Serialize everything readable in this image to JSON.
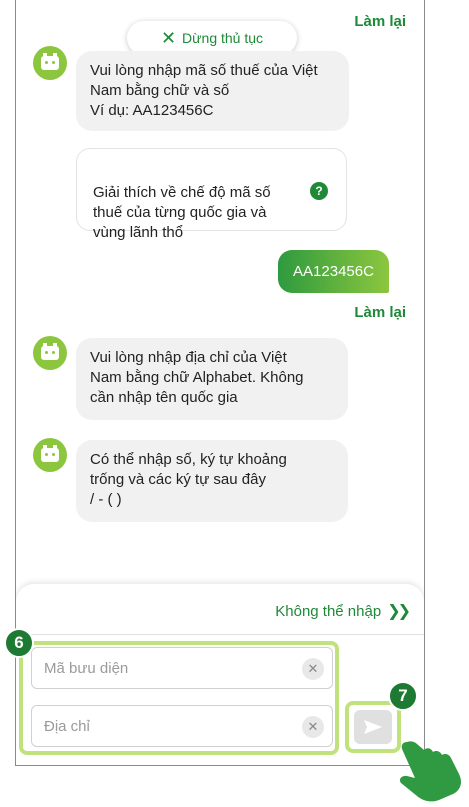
{
  "header": {
    "redo_label": "Làm lại",
    "stop_label": "Dừng thủ tục"
  },
  "messages": {
    "tax_prompt": "Vui lòng nhập mã số thuế của Việt\nNam bằng chữ và số\nVí dụ: AA123456C",
    "explain": "Giải thích về chế độ mã số\nthuế của từng quốc gia và\nvùng lãnh thổ",
    "user_reply": "AA123456C",
    "redo_label": "Làm lại",
    "address_prompt": "Vui lòng nhập địa chỉ của Việt\nNam bằng chữ Alphabet. Không\ncần nhập tên quốc gia",
    "chars_prompt": "Có thể nhập số, ký tự khoảng\ntrống và các ký tự sau đây\n/ - ( )"
  },
  "input_panel": {
    "cannot_enter_label": "Không thể nhập",
    "postal_placeholder": "Mã bưu diện",
    "address_placeholder": "Địa chỉ"
  },
  "badges": {
    "inputs": "6",
    "send": "7"
  },
  "icons": {
    "bot": "bot-face-icon",
    "send": "send-arrow-icon",
    "clear": "clear-x-icon",
    "hand": "tap-hand-icon",
    "help": "question-icon"
  },
  "colors": {
    "accent": "#1e8a38",
    "bot": "#8cc63f",
    "highlight": "#bfe27d",
    "badge": "#1e7a32"
  }
}
